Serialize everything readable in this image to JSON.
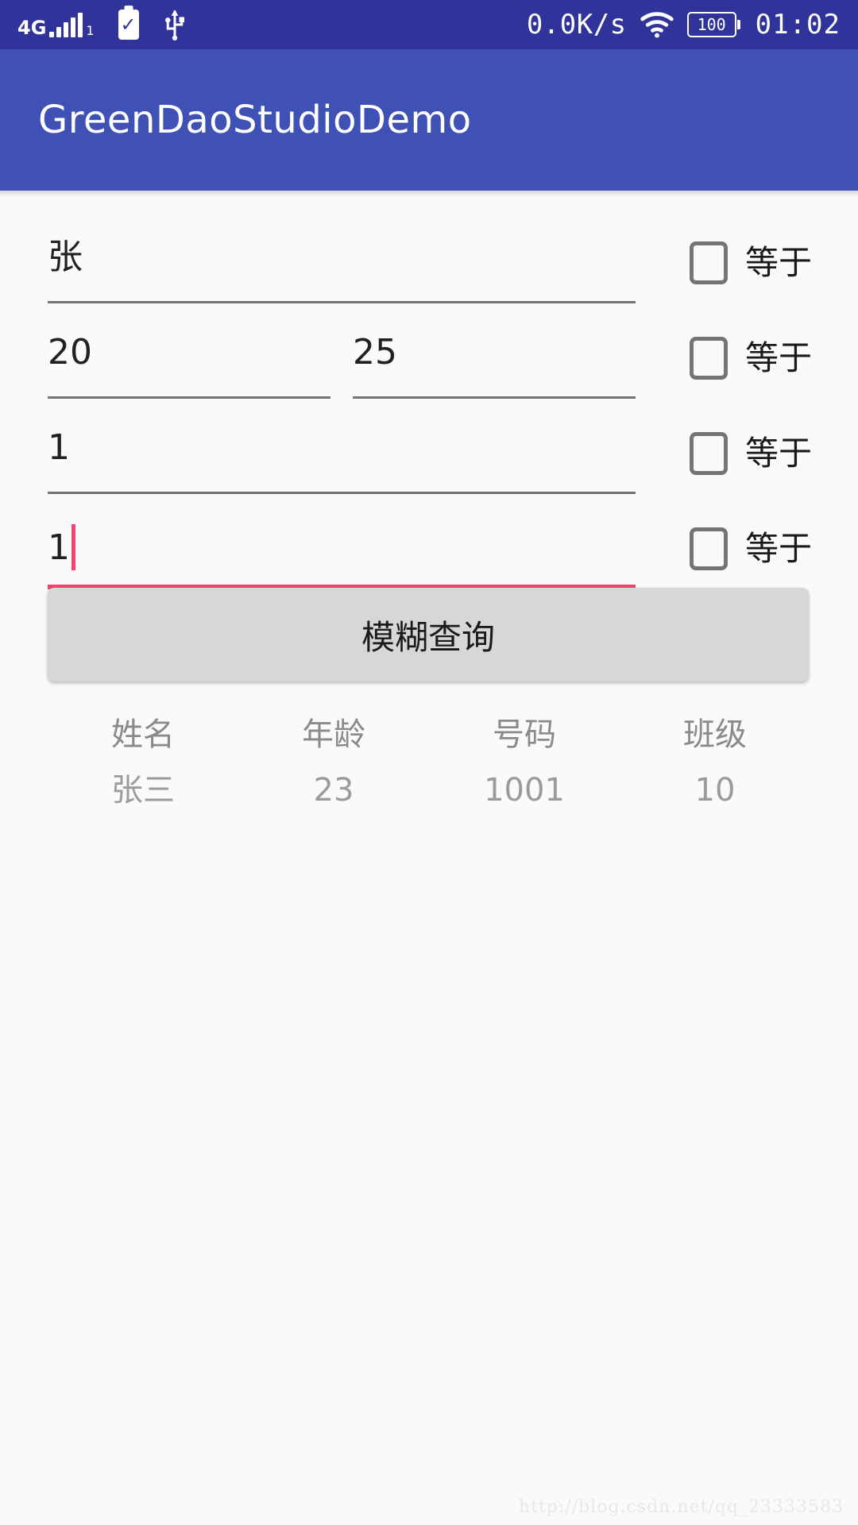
{
  "status_bar": {
    "network_type": "4G",
    "signal_sub": "1",
    "net_speed": "0.0K/s",
    "battery_level": "100",
    "time": "01:02",
    "icons": [
      "signal-icon",
      "battery-check-icon",
      "usb-icon",
      "wifi-icon",
      "battery-icon"
    ],
    "background_color": "#303399"
  },
  "app_bar": {
    "title": "GreenDaoStudioDemo",
    "background_color": "#3f51b5"
  },
  "form": {
    "rows": [
      {
        "fields": [
          {
            "value": "张",
            "width": "wide"
          }
        ],
        "checkbox_label": "等于",
        "checked": false,
        "focused": false
      },
      {
        "fields": [
          {
            "value": "20",
            "width": "half"
          },
          {
            "value": "25",
            "width": "half"
          }
        ],
        "checkbox_label": "等于",
        "checked": false,
        "focused": false
      },
      {
        "fields": [
          {
            "value": "1",
            "width": "wide"
          }
        ],
        "checkbox_label": "等于",
        "checked": false,
        "focused": false
      },
      {
        "fields": [
          {
            "value": "1",
            "width": "wide"
          }
        ],
        "checkbox_label": "等于",
        "checked": false,
        "focused": true
      }
    ],
    "focus_color": "#f4436f",
    "underline_color": "#757575"
  },
  "query_button": {
    "label": "模糊查询",
    "background_color": "#d6d7d7"
  },
  "result_table": {
    "headers": [
      "姓名",
      "年龄",
      "号码",
      "班级"
    ],
    "rows": [
      [
        "张三",
        "23",
        "1001",
        "10"
      ]
    ]
  },
  "watermark": {
    "text": "http://blog.csdn.net/qq_23333583"
  }
}
